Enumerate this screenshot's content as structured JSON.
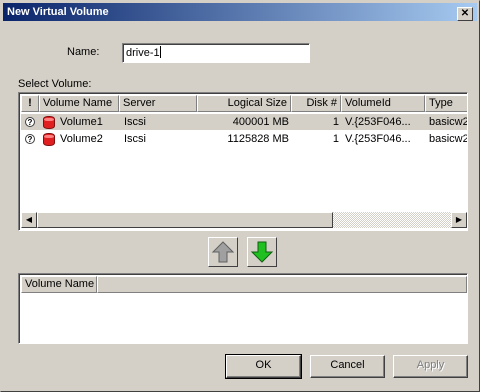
{
  "window": {
    "title": "New Virtual Volume",
    "close_glyph": "✕"
  },
  "form": {
    "name_label": "Name:",
    "name_value": "drive-1",
    "select_label": "Select Volume:"
  },
  "volumes_table": {
    "columns": {
      "status": "!",
      "volume_name": "Volume Name",
      "server": "Server",
      "logical_size": "Logical Size",
      "disk": "Disk #",
      "volume_id": "VolumeId",
      "type": "Type"
    },
    "rows": [
      {
        "status_icon": "question-icon",
        "volume_icon": "database-icon",
        "volume_name": "Volume1",
        "server": "Iscsi",
        "logical_size": "400001 MB",
        "disk": "1",
        "volume_id": "V.{253F046...",
        "type": "basicw2",
        "selected": true
      },
      {
        "status_icon": "question-icon",
        "volume_icon": "database-icon",
        "volume_name": "Volume2",
        "server": "Iscsi",
        "logical_size": "1125828 MB",
        "disk": "1",
        "volume_id": "V.{253F046...",
        "type": "basicw2",
        "selected": false
      }
    ],
    "scroll_left_glyph": "◀",
    "scroll_right_glyph": "▶"
  },
  "move_buttons": {
    "up_icon": "arrow-up-icon",
    "down_icon": "arrow-down-icon",
    "up_color": "#a0a0a0",
    "down_color": "#20c020"
  },
  "selected_table": {
    "columns": {
      "volume_name": "Volume Name"
    },
    "rows": []
  },
  "buttons": {
    "ok": "OK",
    "cancel": "Cancel",
    "apply": "Apply"
  }
}
